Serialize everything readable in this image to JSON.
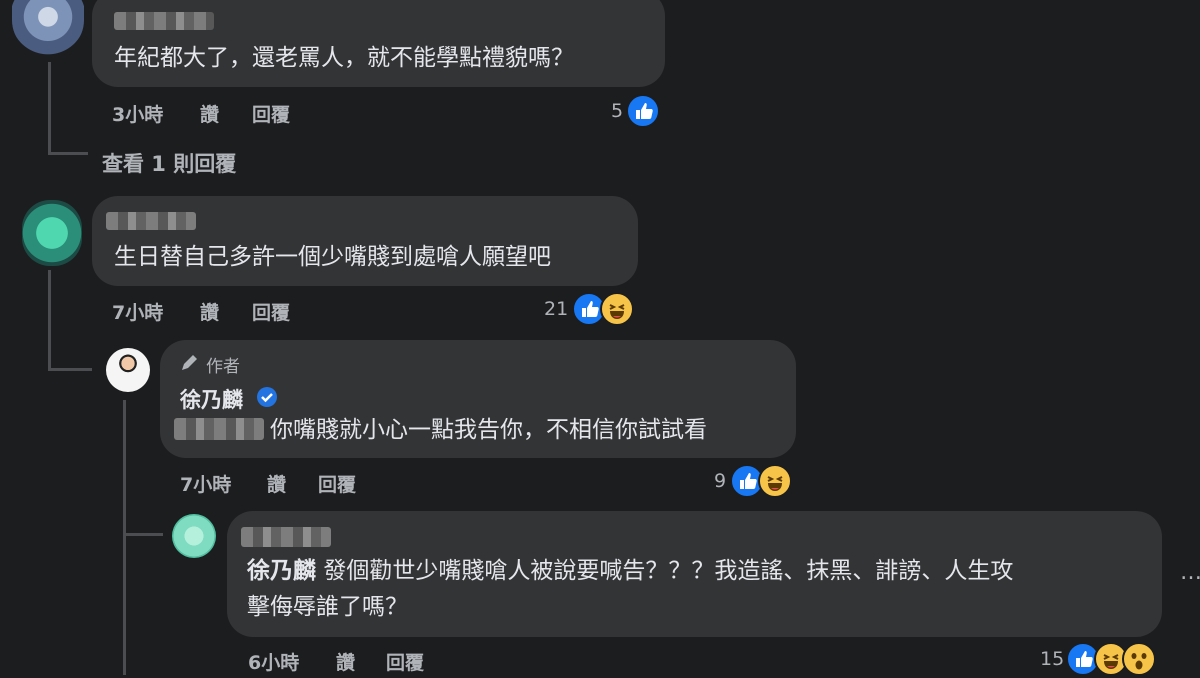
{
  "comments": [
    {
      "text": "年紀都大了，還老罵人，就不能學點禮貌嗎？",
      "time": "3小時",
      "like_label": "讚",
      "reply_label": "回覆",
      "reactions": "5"
    },
    {
      "view_replies": "查看 1 則回覆"
    },
    {
      "text": "生日替自己多許一個少嘴賤到處嗆人願望吧",
      "time": "7小時",
      "like_label": "讚",
      "reply_label": "回覆",
      "reactions": "21"
    },
    {
      "author_badge": "作者",
      "name": "徐乃麟",
      "text": "你嘴賤就小心一點我告你，不相信你試試看",
      "time": "7小時",
      "like_label": "讚",
      "reply_label": "回覆",
      "reactions": "9"
    },
    {
      "mention": "徐乃麟",
      "text_line1": "發個勸世少嘴賤嗆人被說要喊告？？？我造謠、抹黑、誹謗、人生攻",
      "text_line2": "擊侮辱誰了嗎？",
      "time": "6小時",
      "like_label": "讚",
      "reply_label": "回覆",
      "reactions": "15"
    }
  ],
  "more_glyph": "…",
  "icons": [
    "like-icon",
    "haha-icon",
    "wow-icon",
    "pencil-icon",
    "verified-icon"
  ]
}
